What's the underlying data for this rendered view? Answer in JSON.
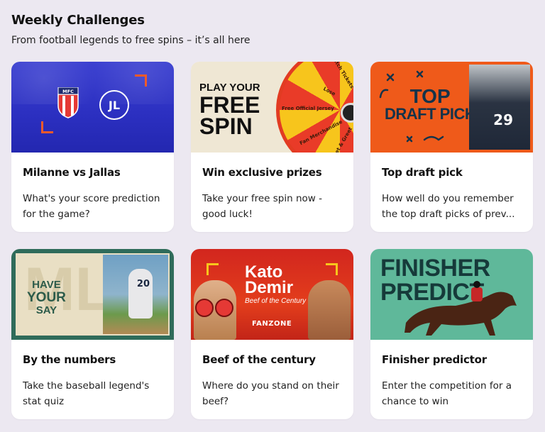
{
  "header": {
    "title": "Weekly Challenges",
    "subtitle": "From football legends to free spins – it’s all here"
  },
  "cards": [
    {
      "title": "Milanne vs Jallas",
      "description": "What's your score prediction for the game?",
      "image": {
        "badge": "MFC",
        "logo": "JL"
      }
    },
    {
      "title": "Win exclusive prizes",
      "description": "Take your free spin now - good luck!",
      "image": {
        "line1": "PLAY YOUR",
        "line2": "FREE",
        "line3": "SPIN",
        "wheel_labels": [
          "Match Tickets",
          "Lose",
          "Free Official Jersey",
          "Fan Merchandise",
          "Meet & Greet"
        ]
      }
    },
    {
      "title": "Top draft pick",
      "description": "How well do you remember the top draft picks of prev...",
      "image": {
        "line1": "TOP",
        "line2": "DRAFT PICK",
        "jersey": "29"
      }
    },
    {
      "title": "By the numbers",
      "description": "Take the baseball legend's stat quiz",
      "image": {
        "bg_text": "MLB",
        "line1": "HAVE",
        "line2": "YOUR",
        "line3": "SAY",
        "jersey": "20"
      }
    },
    {
      "title": "Beef of the century",
      "description": "Where do you stand on their beef?",
      "image": {
        "line1": "Kato",
        "line2": "Demir",
        "tagline": "Beef of the Century",
        "brand": "FANZONE"
      }
    },
    {
      "title": "Finisher predictor",
      "description": "Enter the competition for a chance to win",
      "image": {
        "line1": "FINISHER",
        "line2": "PREDICT"
      }
    }
  ],
  "colors": {
    "background": "#ece8f1",
    "card": "#ffffff",
    "accent_blue": "#2b2fc0",
    "accent_orange": "#ef5a1a",
    "accent_green": "#5fb89a"
  }
}
